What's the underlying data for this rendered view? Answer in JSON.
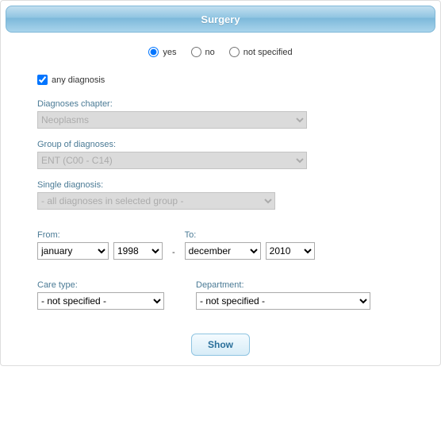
{
  "header": {
    "title": "Surgery"
  },
  "options": {
    "yes": "yes",
    "no": "no",
    "not_specified": "not specified",
    "selected": "yes"
  },
  "any_diagnosis": {
    "label": "any diagnosis",
    "checked": true
  },
  "diagnoses_chapter": {
    "label": "Diagnoses chapter:",
    "value": "Neoplasms"
  },
  "group_of_diagnoses": {
    "label": "Group of diagnoses:",
    "value": "ENT (C00 - C14)"
  },
  "single_diagnosis": {
    "label": "Single diagnosis:",
    "value": "- all diagnoses in selected group -"
  },
  "from": {
    "label": "From:",
    "month": "january",
    "year": "1998"
  },
  "to": {
    "label": "To:",
    "month": "december",
    "year": "2010"
  },
  "care_type": {
    "label": "Care type:",
    "value": "- not specified -"
  },
  "department": {
    "label": "Department:",
    "value": "- not specified -"
  },
  "show": {
    "label": "Show"
  }
}
